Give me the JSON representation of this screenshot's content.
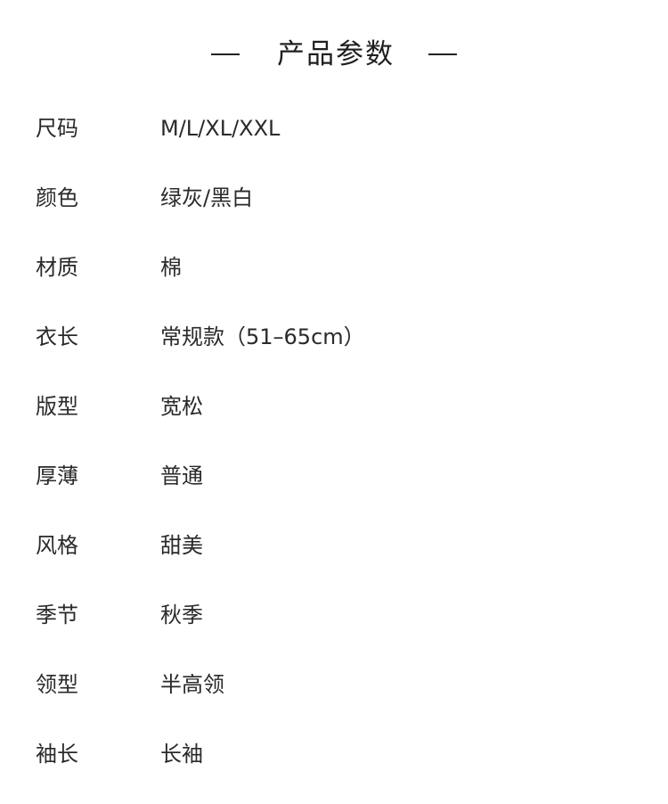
{
  "header": {
    "title": "产品参数"
  },
  "specs": [
    {
      "label": "尺码",
      "value": "M/L/XL/XXL"
    },
    {
      "label": "颜色",
      "value": "绿灰/黑白"
    },
    {
      "label": "材质",
      "value": "棉"
    },
    {
      "label": "衣长",
      "value": "常规款（51–65cm）"
    },
    {
      "label": "版型",
      "value": "宽松"
    },
    {
      "label": "厚薄",
      "value": "普通"
    },
    {
      "label": "风格",
      "value": "甜美"
    },
    {
      "label": "季节",
      "value": "秋季"
    },
    {
      "label": "领型",
      "value": "半高领"
    },
    {
      "label": "袖长",
      "value": "长袖"
    }
  ]
}
